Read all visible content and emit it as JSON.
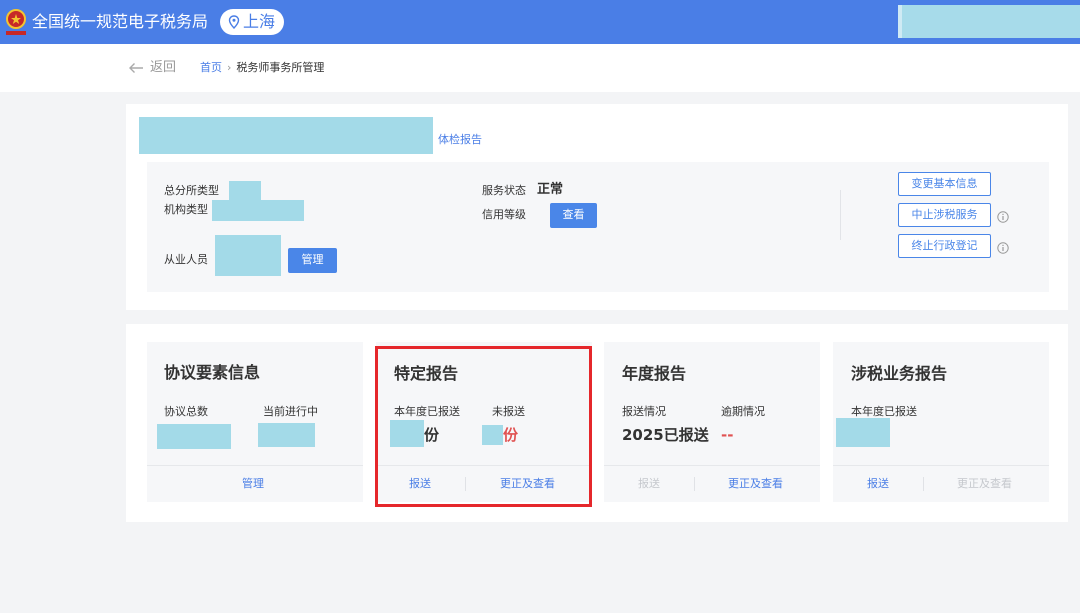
{
  "header": {
    "app_title": "全国统一规范电子税务局",
    "region": "上海",
    "logo_icon": "national-emblem-icon",
    "pin_icon": "location-pin-icon"
  },
  "breadcrumb": {
    "back_label": "返回",
    "home": "首页",
    "separator": "›",
    "current": "税务师事务所管理"
  },
  "profile": {
    "health_report_link": "体检报告",
    "branch_type_label": "总分所类型",
    "org_type_label": "机构类型",
    "staff_label": "从业人员",
    "manage_button": "管理",
    "service_status_label": "服务状态",
    "service_status_value": "正常",
    "credit_level_label": "信用等级",
    "view_button": "查看",
    "actions": {
      "change_info": "变更基本信息",
      "suspend_service": "中止涉税服务",
      "terminate_registration": "终止行政登记"
    }
  },
  "cards": {
    "agreement": {
      "title": "协议要素信息",
      "total_label": "协议总数",
      "in_progress_label": "当前进行中",
      "manage_link": "管理"
    },
    "special": {
      "title": "特定报告",
      "reported_label": "本年度已报送",
      "unreported_label": "未报送",
      "unit": "份",
      "submit_link": "报送",
      "correct_link": "更正及查看"
    },
    "annual": {
      "title": "年度报告",
      "status_label": "报送情况",
      "overdue_label": "逾期情况",
      "status_value": "2025已报送",
      "overdue_value": "--",
      "submit_link": "报送",
      "correct_link": "更正及查看"
    },
    "tax": {
      "title": "涉税业务报告",
      "reported_label": "本年度已报送",
      "submit_link": "报送",
      "correct_link": "更正及查看"
    }
  },
  "colors": {
    "brand_blue": "#4a7ee6",
    "highlight_red": "#e5272b",
    "value_red": "#e05252",
    "redaction": "#a3dae8"
  }
}
